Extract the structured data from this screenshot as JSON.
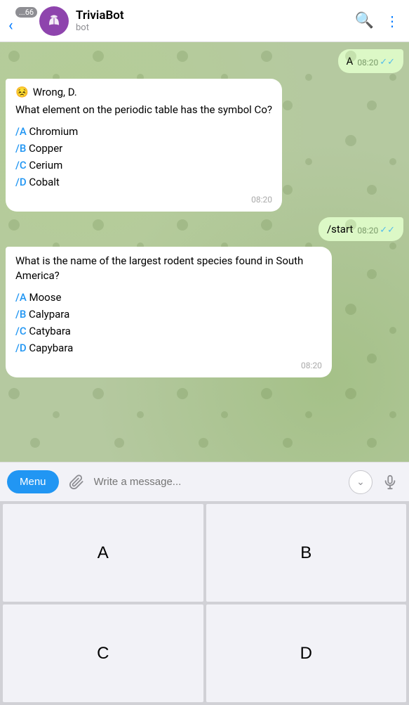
{
  "header": {
    "back_badge": "...66",
    "title": "TriviaBot",
    "subtitle": "bot",
    "search_label": "search",
    "more_label": "more"
  },
  "messages": [
    {
      "id": "msg-sent-start",
      "type": "right",
      "text": "A",
      "time": "08:20",
      "read": true
    },
    {
      "id": "msg-bot-wrong",
      "type": "left",
      "emoji": "😣",
      "header_text": "Wrong, D.",
      "question": "What element on the periodic table has the symbol Co?",
      "options": [
        {
          "letter": "/A",
          "text": "Chromium"
        },
        {
          "letter": "/B",
          "text": "Copper"
        },
        {
          "letter": "/C",
          "text": "Cerium"
        },
        {
          "letter": "/D",
          "text": "Cobalt"
        }
      ],
      "time": "08:20"
    },
    {
      "id": "msg-sent-slash-start",
      "type": "right",
      "text": "/start",
      "time": "08:20",
      "read": true
    },
    {
      "id": "msg-bot-question2",
      "type": "left",
      "question": "What is the name of the largest rodent species found in South America?",
      "options": [
        {
          "letter": "/A",
          "text": "Moose"
        },
        {
          "letter": "/B",
          "text": "Calypara"
        },
        {
          "letter": "/C",
          "text": "Catybara"
        },
        {
          "letter": "/D",
          "text": "Capybara"
        }
      ],
      "time": "08:20"
    }
  ],
  "input": {
    "menu_label": "Menu",
    "placeholder": "Write a message..."
  },
  "keyboard": {
    "keys": [
      "A",
      "B",
      "C",
      "D"
    ]
  }
}
